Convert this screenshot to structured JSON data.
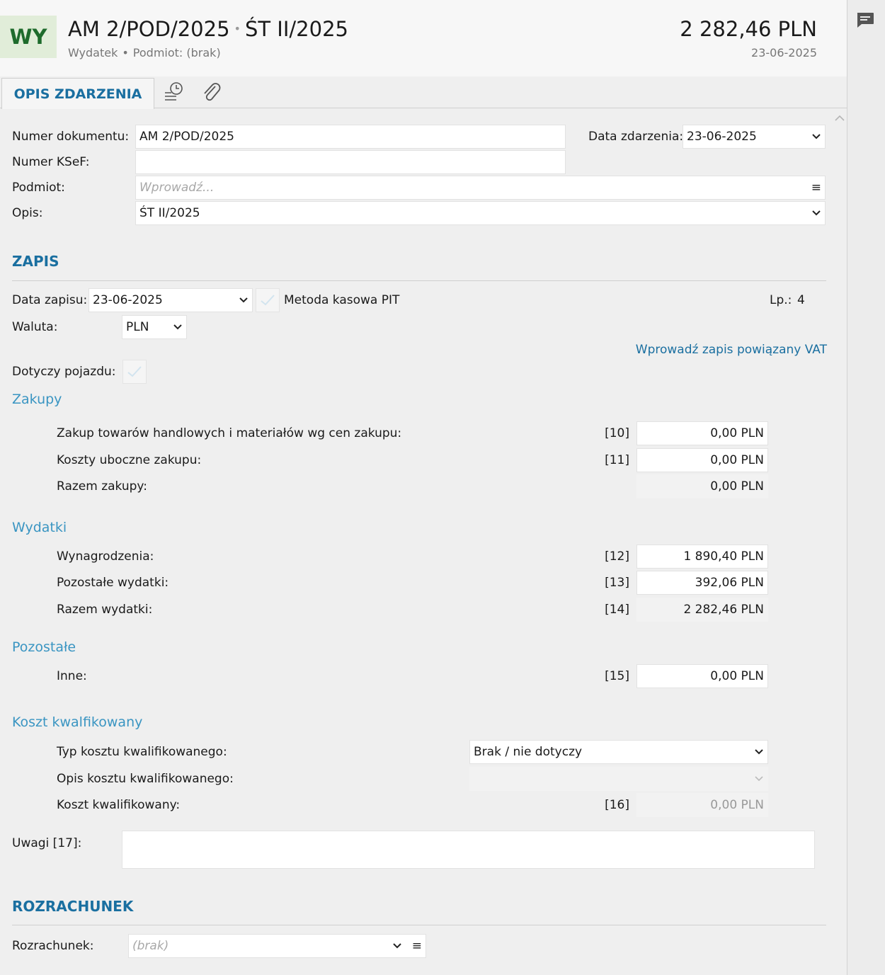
{
  "header": {
    "badge": "WY",
    "document_number": "AM 2/POD/2025",
    "title_separator": "•",
    "description": "ŚT II/2025",
    "type": "Wydatek",
    "subtitle_separator": "•",
    "subject": "Podmiot: (brak)",
    "amount": "2 282,46 PLN",
    "date": "23-06-2025"
  },
  "tabs": {
    "opis_label": "OPIS ZDARZENIA",
    "history_icon": "history-icon",
    "attachment_icon": "paperclip-icon"
  },
  "event": {
    "doc_number_label": "Numer dokumentu:",
    "doc_number_value": "AM 2/POD/2025",
    "date_label": "Data zdarzenia:",
    "date_value": "23-06-2025",
    "ksef_label": "Numer KSeF:",
    "ksef_value": "",
    "subject_label": "Podmiot:",
    "subject_placeholder": "Wprowadź...",
    "subject_menu_icon": "≡",
    "description_label": "Opis:",
    "description_value": "ŚT II/2025"
  },
  "zapis": {
    "section_title": "ZAPIS",
    "date_label": "Data zapisu:",
    "date_value": "23-06-2025",
    "cash_method_label": "Metoda kasowa PIT",
    "lp_label": "Lp.:",
    "lp_value": "4",
    "currency_label": "Waluta:",
    "currency_value": "PLN",
    "vat_link": "Wprowadź zapis powiązany VAT",
    "vehicle_label": "Dotyczy pojazdu:"
  },
  "zakupy": {
    "title": "Zakupy",
    "rows": [
      {
        "label": "Zakup towarów handlowych i materiałów wg cen zakupu:",
        "code": "[10]",
        "value": "0,00 PLN"
      },
      {
        "label": "Koszty uboczne zakupu:",
        "code": "[11]",
        "value": "0,00 PLN"
      },
      {
        "label": "Razem zakupy:",
        "code": "",
        "value": "0,00 PLN"
      }
    ]
  },
  "wydatki": {
    "title": "Wydatki",
    "rows": [
      {
        "label": "Wynagrodzenia:",
        "code": "[12]",
        "value": "1 890,40 PLN"
      },
      {
        "label": "Pozostałe wydatki:",
        "code": "[13]",
        "value": "392,06 PLN"
      },
      {
        "label": "Razem wydatki:",
        "code": "[14]",
        "value": "2 282,46 PLN"
      }
    ]
  },
  "pozostale": {
    "title": "Pozostałe",
    "rows": [
      {
        "label": "Inne:",
        "code": "[15]",
        "value": "0,00 PLN"
      }
    ]
  },
  "koszt": {
    "title": "Koszt kwalfikowany",
    "type_label": "Typ kosztu kwalifikowanego:",
    "type_value": "Brak / nie dotyczy",
    "desc_label": "Opis kosztu kwalifikowanego:",
    "desc_value": "",
    "amount_label": "Koszt kwalifikowany:",
    "amount_code": "[16]",
    "amount_value": "0,00 PLN"
  },
  "uwagi": {
    "label": "Uwagi [17]:",
    "value": ""
  },
  "rozrachunek": {
    "section_title": "ROZRACHUNEK",
    "label": "Rozrachunek:",
    "placeholder": "(brak)",
    "menu_icon": "≡"
  },
  "colors": {
    "accent": "#1a6fa0",
    "group": "#3a95c2",
    "badge_bg": "#e1edd9",
    "badge_fg": "#1e6b2c"
  }
}
